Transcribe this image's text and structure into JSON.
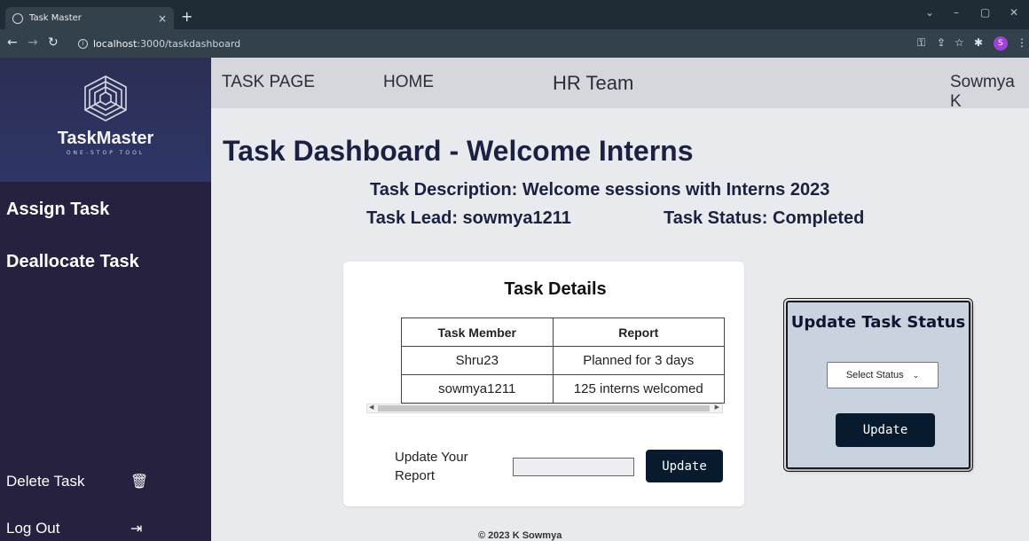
{
  "browser": {
    "tab_title": "Task Master",
    "tab_close": "×",
    "new_tab": "+",
    "url_host": "localhost",
    "url_rest": ":3000/taskdashboard"
  },
  "sidebar": {
    "brand_name": "TaskMaster",
    "brand_tag": "ONE-STOP TOOL",
    "items": [
      {
        "label": "Assign Task"
      },
      {
        "label": "Deallocate Task"
      }
    ],
    "delete_label": "Delete Task",
    "logout_label": "Log Out"
  },
  "topnav": {
    "task_page": "TASK PAGE",
    "home": "HOME",
    "team": "HR Team",
    "user": "Sowmya K"
  },
  "main": {
    "title": "Task Dashboard - Welcome Interns",
    "description": "Task Description: Welcome sessions with Interns 2023",
    "lead": "Task Lead: sowmya1211",
    "status": "Task Status: Completed"
  },
  "details": {
    "title": "Task Details",
    "columns": [
      "Task Member",
      "Report"
    ],
    "rows": [
      [
        "Shru23",
        "Planned for 3 days"
      ],
      [
        "sowmya1211",
        "125 interns welcomed"
      ]
    ],
    "report_label": "Update Your Report",
    "report_value": "",
    "update_button": "Update"
  },
  "status_panel": {
    "title": "Update Task Status",
    "select_value": "Select Status",
    "update_button": "Update"
  },
  "footer": "© 2023 K Sowmya",
  "colors": {
    "sidebar": "#25213f",
    "button": "#071a2e",
    "status_panel": "#c9d2df"
  }
}
